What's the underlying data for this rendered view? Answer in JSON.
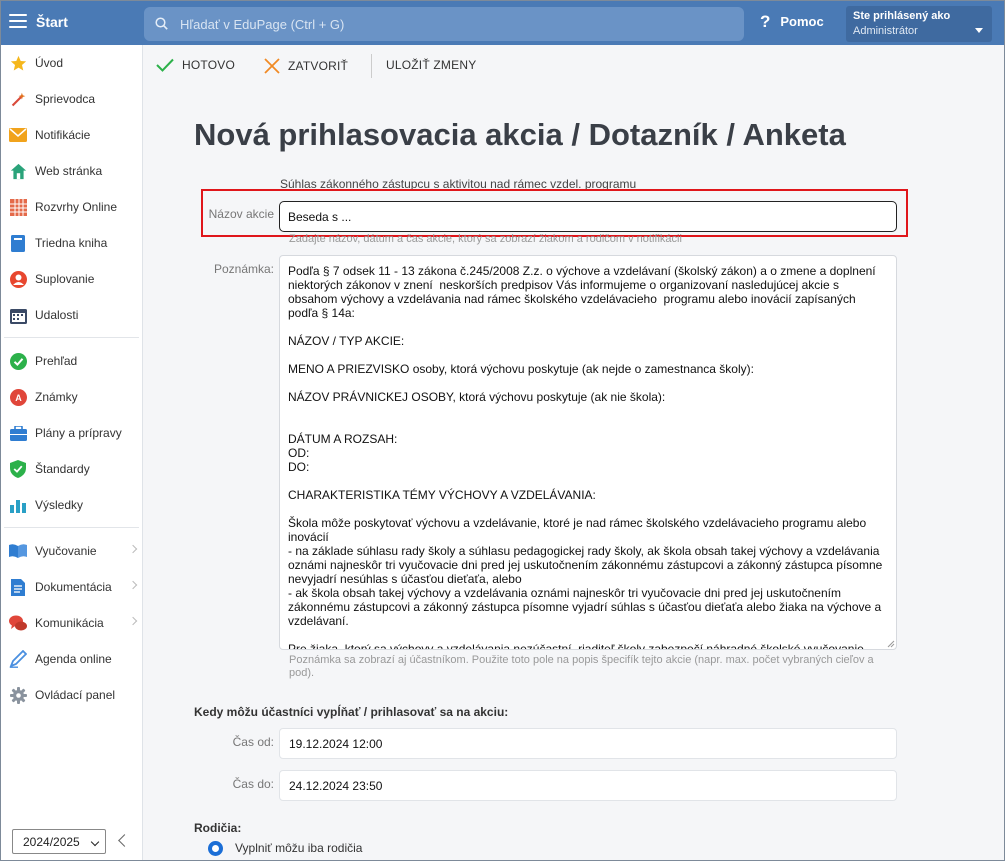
{
  "topbar": {
    "app_title": "Štart",
    "search_placeholder": "Hľadať v EduPage (Ctrl + G)",
    "help_label": "Pomoc",
    "help_glyph": "?",
    "user_line1": "Ste prihlásený ako",
    "user_line2": "Administrátor",
    "bar_color": "#4a7ab5"
  },
  "sidebar": {
    "items": [
      {
        "label": "Úvod",
        "icon": "star-icon"
      },
      {
        "label": "Sprievodca",
        "icon": "magic-wand-icon"
      },
      {
        "label": "Notifikácie",
        "icon": "envelope-icon"
      },
      {
        "label": "Web stránka",
        "icon": "house-icon"
      },
      {
        "label": "Rozvrhy Online",
        "icon": "timetable-grid-icon"
      },
      {
        "label": "Triedna kniha",
        "icon": "book-icon"
      },
      {
        "label": "Suplovanie",
        "icon": "person-icon"
      },
      {
        "label": "Udalosti",
        "icon": "calendar-icon"
      },
      {
        "label": "Prehľad",
        "icon": "check-circle-icon"
      },
      {
        "label": "Známky",
        "icon": "grade-badge-icon"
      },
      {
        "label": "Plány a prípravy",
        "icon": "briefcase-icon"
      },
      {
        "label": "Štandardy",
        "icon": "shield-check-icon"
      },
      {
        "label": "Výsledky",
        "icon": "bar-chart-icon"
      },
      {
        "label": "Vyučovanie",
        "icon": "open-book-icon"
      },
      {
        "label": "Dokumentácia",
        "icon": "document-icon"
      },
      {
        "label": "Komunikácia",
        "icon": "chat-bubbles-icon"
      },
      {
        "label": "Agenda online",
        "icon": "pen-icon"
      },
      {
        "label": "Ovládací panel",
        "icon": "gear-icon"
      }
    ],
    "school_year": "2024/2025"
  },
  "toolbar": {
    "done_label": "HOTOVO",
    "close_label": "ZATVORIŤ",
    "save_label": "ULOŽIŤ ZMENY"
  },
  "form": {
    "title": "Nová prihlasovacia akcia / Dotazník / Anketa",
    "above_name_text": "Súhlas zákonného zástupcu s aktivitou nad rámec vzdel. programu",
    "name_label": "Názov akcie",
    "name_value": "Beseda s ...",
    "name_hint": "Zadajte názov, dátum a čas akcie, ktorý sa zobrazí žiakom a rodičom v notifikácii",
    "note_label": "Poznámka:",
    "note_paragraphs": [
      "Podľa § 7 odsek 11 - 13 zákona č.245/2008 Z.z. o výchove a vzdelávaní (školský zákon) a o zmene a doplnení niektorých zákonov v znení  neskorších predpisov Vás informujeme o organizovaní nasledujúcej akcie s obsahom výchovy a vzdelávania nad rámec školského vzdelávacieho  programu alebo inovácií zapísaných podľa § 14a:",
      "",
      "NÁZOV / TYP AKCIE:",
      "",
      "MENO A PRIEZVISKO osoby, ktorá výchovu poskytuje (ak nejde o zamestnanca školy):",
      "",
      "NÁZOV PRÁVNICKEJ OSOBY, ktorá výchovu poskytuje (ak nie škola):",
      "",
      "",
      "DÁTUM A ROZSAH:",
      "OD:",
      "DO:",
      "",
      "CHARAKTERISTIKA TÉMY VÝCHOVY A VZDELÁVANIA:",
      "",
      "Škola môže poskytovať výchovu a vzdelávanie, ktoré je nad rámec školského vzdelávacieho programu alebo inovácií",
      "- na základe súhlasu rady školy a súhlasu pedagogickej rady školy, ak škola obsah takej výchovy a vzdelávania oznámi najneskôr tri vyučovacie dni pred jej uskutočnením zákonnému zástupcovi a zákonný zástupca písomne nevyjadrí nesúhlas s účasťou dieťaťa, alebo",
      "- ak škola obsah takej výchovy a vzdelávania oznámi najneskôr tri vyučovacie dni pred jej uskutočnením zákonnému zástupcovi a zákonný zástupca písomne vyjadrí súhlas s účasťou dieťaťa alebo žiaka na výchove a vzdelávaní.",
      "",
      "Pre žiaka, ktorý sa výchovy a vzdelávania nezúčastní, riaditeľ školy zabezpečí náhradné školské vyučovanie."
    ],
    "note_hint": "Poznámka sa zobrazí aj účastníkom. Použite toto pole na popis špecifík tejto akcie (napr. max. počet vybraných cieľov a pod).",
    "when_heading": "Kedy môžu účastníci vypĺňať / prihlasovať sa na akciu:",
    "from_label": "Čas od:",
    "from_value": "19.12.2024 12:00",
    "to_label": "Čas do:",
    "to_value": "24.12.2024 23:50",
    "parents_heading": "Rodičia:",
    "parents_option": "Vyplniť môžu iba rodičia",
    "highlight_color": "#e0161b"
  }
}
